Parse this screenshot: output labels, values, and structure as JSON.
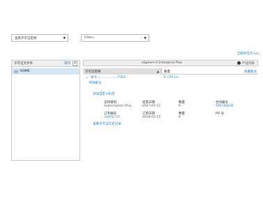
{
  "filters": {
    "folder_select": "查看许可证密钥",
    "filter_select": "Filters"
  },
  "export_link": "全部导出为 csv",
  "left_panel": {
    "header": "许可证文件夹",
    "manage": "操作",
    "add": "+",
    "home": "HOME"
  },
  "right_panel": {
    "title": "vSphere 6 Enterprise Plus",
    "product_list": "产品列表",
    "col_key": "许可证密钥",
    "col_qty": "数量",
    "hide_link": "隐藏备注",
    "row": {
      "key": "8F4.....................F5H2",
      "qty": "6 CPU (s)",
      "note": "添加备注"
    },
    "add_custom_label": "添加自定义标签",
    "details": {
      "support_level_label": "支持级别",
      "support_level_value": "Subscription Only",
      "expiry_label": "结束日期",
      "expiry_value": "2017-07-27",
      "qty1_label": "数量",
      "qty1_value": "6",
      "contract_label": "合同编号",
      "contract_value": "446706036",
      "order_label": "订单编号",
      "order_value": "33422725",
      "order_date_label": "订单日期",
      "order_date_value": "2016-03-15",
      "qty2_label": "数量",
      "qty2_value": "6",
      "po_label": "PO 号",
      "po_value": ""
    },
    "history_link": "查看许可证历史记录"
  }
}
